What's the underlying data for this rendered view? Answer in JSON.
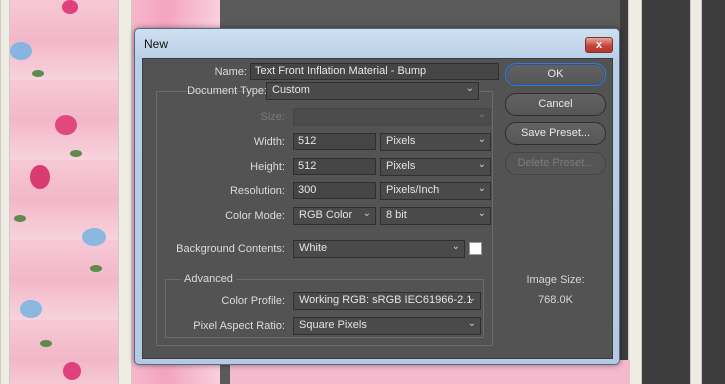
{
  "dialog": {
    "title": "New",
    "close_glyph": "x"
  },
  "form": {
    "name_label": "Name:",
    "name_value": "Text Front Inflation Material - Bump",
    "document_type_label": "Document Type:",
    "document_type_value": "Custom",
    "size_label": "Size:",
    "size_value": "",
    "width_label": "Width:",
    "width_value": "512",
    "width_unit": "Pixels",
    "height_label": "Height:",
    "height_value": "512",
    "height_unit": "Pixels",
    "resolution_label": "Resolution:",
    "resolution_value": "300",
    "resolution_unit": "Pixels/Inch",
    "color_mode_label": "Color Mode:",
    "color_mode_value": "RGB Color",
    "bit_depth_value": "8 bit",
    "background_label": "Background Contents:",
    "background_value": "White",
    "background_swatch_color": "#ffffff"
  },
  "advanced": {
    "title": "Advanced",
    "color_profile_label": "Color Profile:",
    "color_profile_value": "Working RGB:  sRGB IEC61966-2.1",
    "pixel_aspect_label": "Pixel Aspect Ratio:",
    "pixel_aspect_value": "Square Pixels"
  },
  "buttons": {
    "ok": "OK",
    "cancel": "Cancel",
    "save_preset": "Save Preset...",
    "delete_preset": "Delete Preset..."
  },
  "image_size": {
    "label": "Image Size:",
    "value": "768.0K"
  },
  "icons": {
    "dropdown": "chevron-down-icon",
    "close": "close-icon"
  },
  "colors": {
    "dialog_body": "#535353",
    "window_frame": "#b9cfe7",
    "accent_focus": "#3b78c4",
    "close_button": "#c7443a"
  }
}
